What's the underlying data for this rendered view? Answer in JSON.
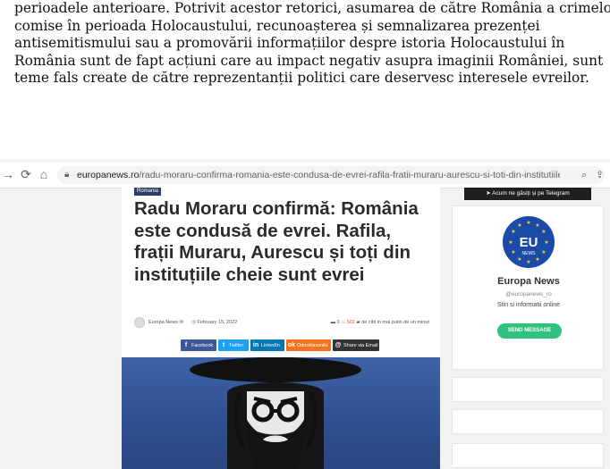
{
  "document": {
    "lines": [
      "perioadele anterioare. Potrivit acestor retorici, asumarea de către România a crimelor",
      "comise în perioada Holocaustului, recunoașterea și semnalizarea prezenței",
      "antisemitismului sau a promovării informațiilor despre istoria Holocaustului în",
      "România sunt de fapt acțiuni care au impact negativ asupra imaginii României, sunt",
      "teme fals create de către reprezentanții politici care deservesc interesele evreilor."
    ]
  },
  "browser": {
    "url_host": "europanews.ro",
    "url_path": "/radu-moraru-confirma-romania-este-condusa-de-evrei-rafila-fratii-muraru-aurescu-si-toti-din-institutiile-cheie-...",
    "icons": [
      "back-arrow-icon",
      "reload-icon",
      "home-icon",
      "lock-icon",
      "zoom-icon",
      "share-icon"
    ]
  },
  "article": {
    "category": "Romania",
    "title_lines": [
      "Radu Moraru confirmă: România",
      "este condusă de evrei. Rafila,",
      "frații Muraru, Aurescu și toți din",
      "instituțiile cheie sunt evrei"
    ],
    "author": "Europa News",
    "date": "February 15, 2022",
    "comments": "0",
    "views": "502",
    "read_time": "de citit in mai putin de un minut",
    "share_buttons": [
      {
        "label": "Facebook",
        "icon": "f",
        "color": "#3b5998"
      },
      {
        "label": "Twitter",
        "icon": "t",
        "color": "#1da1f2"
      },
      {
        "label": "LinkedIn",
        "icon": "in",
        "color": "#0077b5"
      },
      {
        "label": "Odnoklassniki",
        "icon": "ok",
        "color": "#f4731c"
      },
      {
        "label": "Share via Email",
        "icon": "@",
        "color": "#333333"
      }
    ]
  },
  "sidebar": {
    "telegram_label": "Acum ne găsiți și pe Telegram",
    "logo_text": "EU",
    "logo_subtext": "NEWS",
    "brand_name": "Europa News",
    "handle": "@europanews_ro",
    "description": "Stiri si informatii online",
    "send_button": "SEND MESSAGE"
  }
}
